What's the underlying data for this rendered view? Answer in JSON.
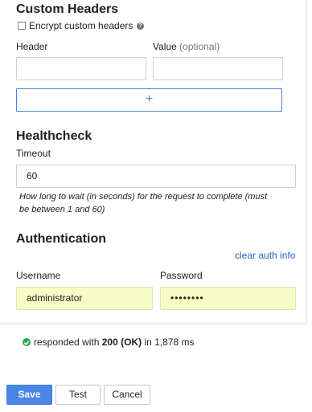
{
  "custom_headers": {
    "title": "Custom Headers",
    "encrypt_label": "Encrypt custom headers",
    "header_label": "Header",
    "value_label": "Value",
    "value_hint": "(optional)",
    "header_value": "",
    "value_value": "",
    "add_label": "+"
  },
  "healthcheck": {
    "title": "Healthcheck",
    "timeout_label": "Timeout",
    "timeout_value": "60",
    "help_line1": "How long to wait (in seconds) for the request to complete (must",
    "help_line2": "be between 1 and 60)"
  },
  "authentication": {
    "title": "Authentication",
    "clear_link": "clear auth info",
    "username_label": "Username",
    "username_value": "administrator",
    "password_label": "Password",
    "password_value": "••••••••"
  },
  "status": {
    "prefix": "responded with",
    "code": "200 (OK)",
    "mid": "in",
    "time": "1,878 ms"
  },
  "actions": {
    "save_label": "Save",
    "test_label": "Test",
    "cancel_label": "Cancel"
  }
}
